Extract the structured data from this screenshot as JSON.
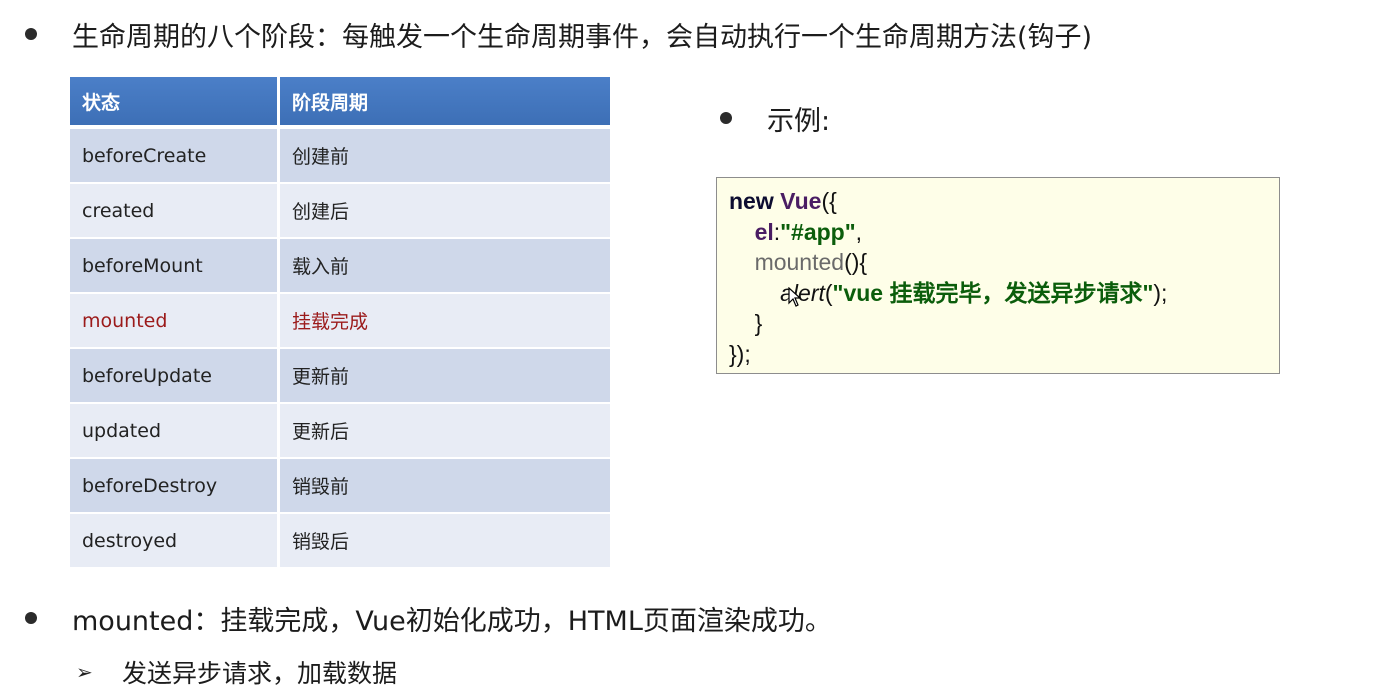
{
  "intro": {
    "text": "生命周期的八个阶段：每触发一个生命周期事件，会自动执行一个生命周期方法(钩子)"
  },
  "table": {
    "headers": [
      "状态",
      "阶段周期"
    ],
    "rows": [
      {
        "state": "beforeCreate",
        "phase": "创建前"
      },
      {
        "state": "created",
        "phase": "创建后"
      },
      {
        "state": "beforeMount",
        "phase": "载入前"
      },
      {
        "state": "mounted",
        "phase": "挂载完成"
      },
      {
        "state": "beforeUpdate",
        "phase": "更新前"
      },
      {
        "state": "updated",
        "phase": "更新后"
      },
      {
        "state": "beforeDestroy",
        "phase": "销毁前"
      },
      {
        "state": "destroyed",
        "phase": "销毁后"
      }
    ],
    "header_color": "#4a7cc4",
    "highlight_color": "#9b1a1a"
  },
  "example": {
    "label": "示例:",
    "code": {
      "l1_kw": "new",
      "l1_cls": "Vue",
      "l1_rest": "({",
      "l2_prop": "el",
      "l2_colon": ":",
      "l2_str": "\"#app\"",
      "l2_rest": ",",
      "l3_meth": "mounted",
      "l3_rest": "(){",
      "l4_fn": "alert",
      "l4_open": "(",
      "l4_str": "\"vue 挂载完毕，发送异步请求\"",
      "l4_rest": ");",
      "l5": "}",
      "l6": "});"
    }
  },
  "mounted_note": {
    "text": "mounted：挂载完成，Vue初始化成功，HTML页面渲染成功。"
  },
  "sub_note": {
    "text": "发送异步请求，加载数据"
  }
}
